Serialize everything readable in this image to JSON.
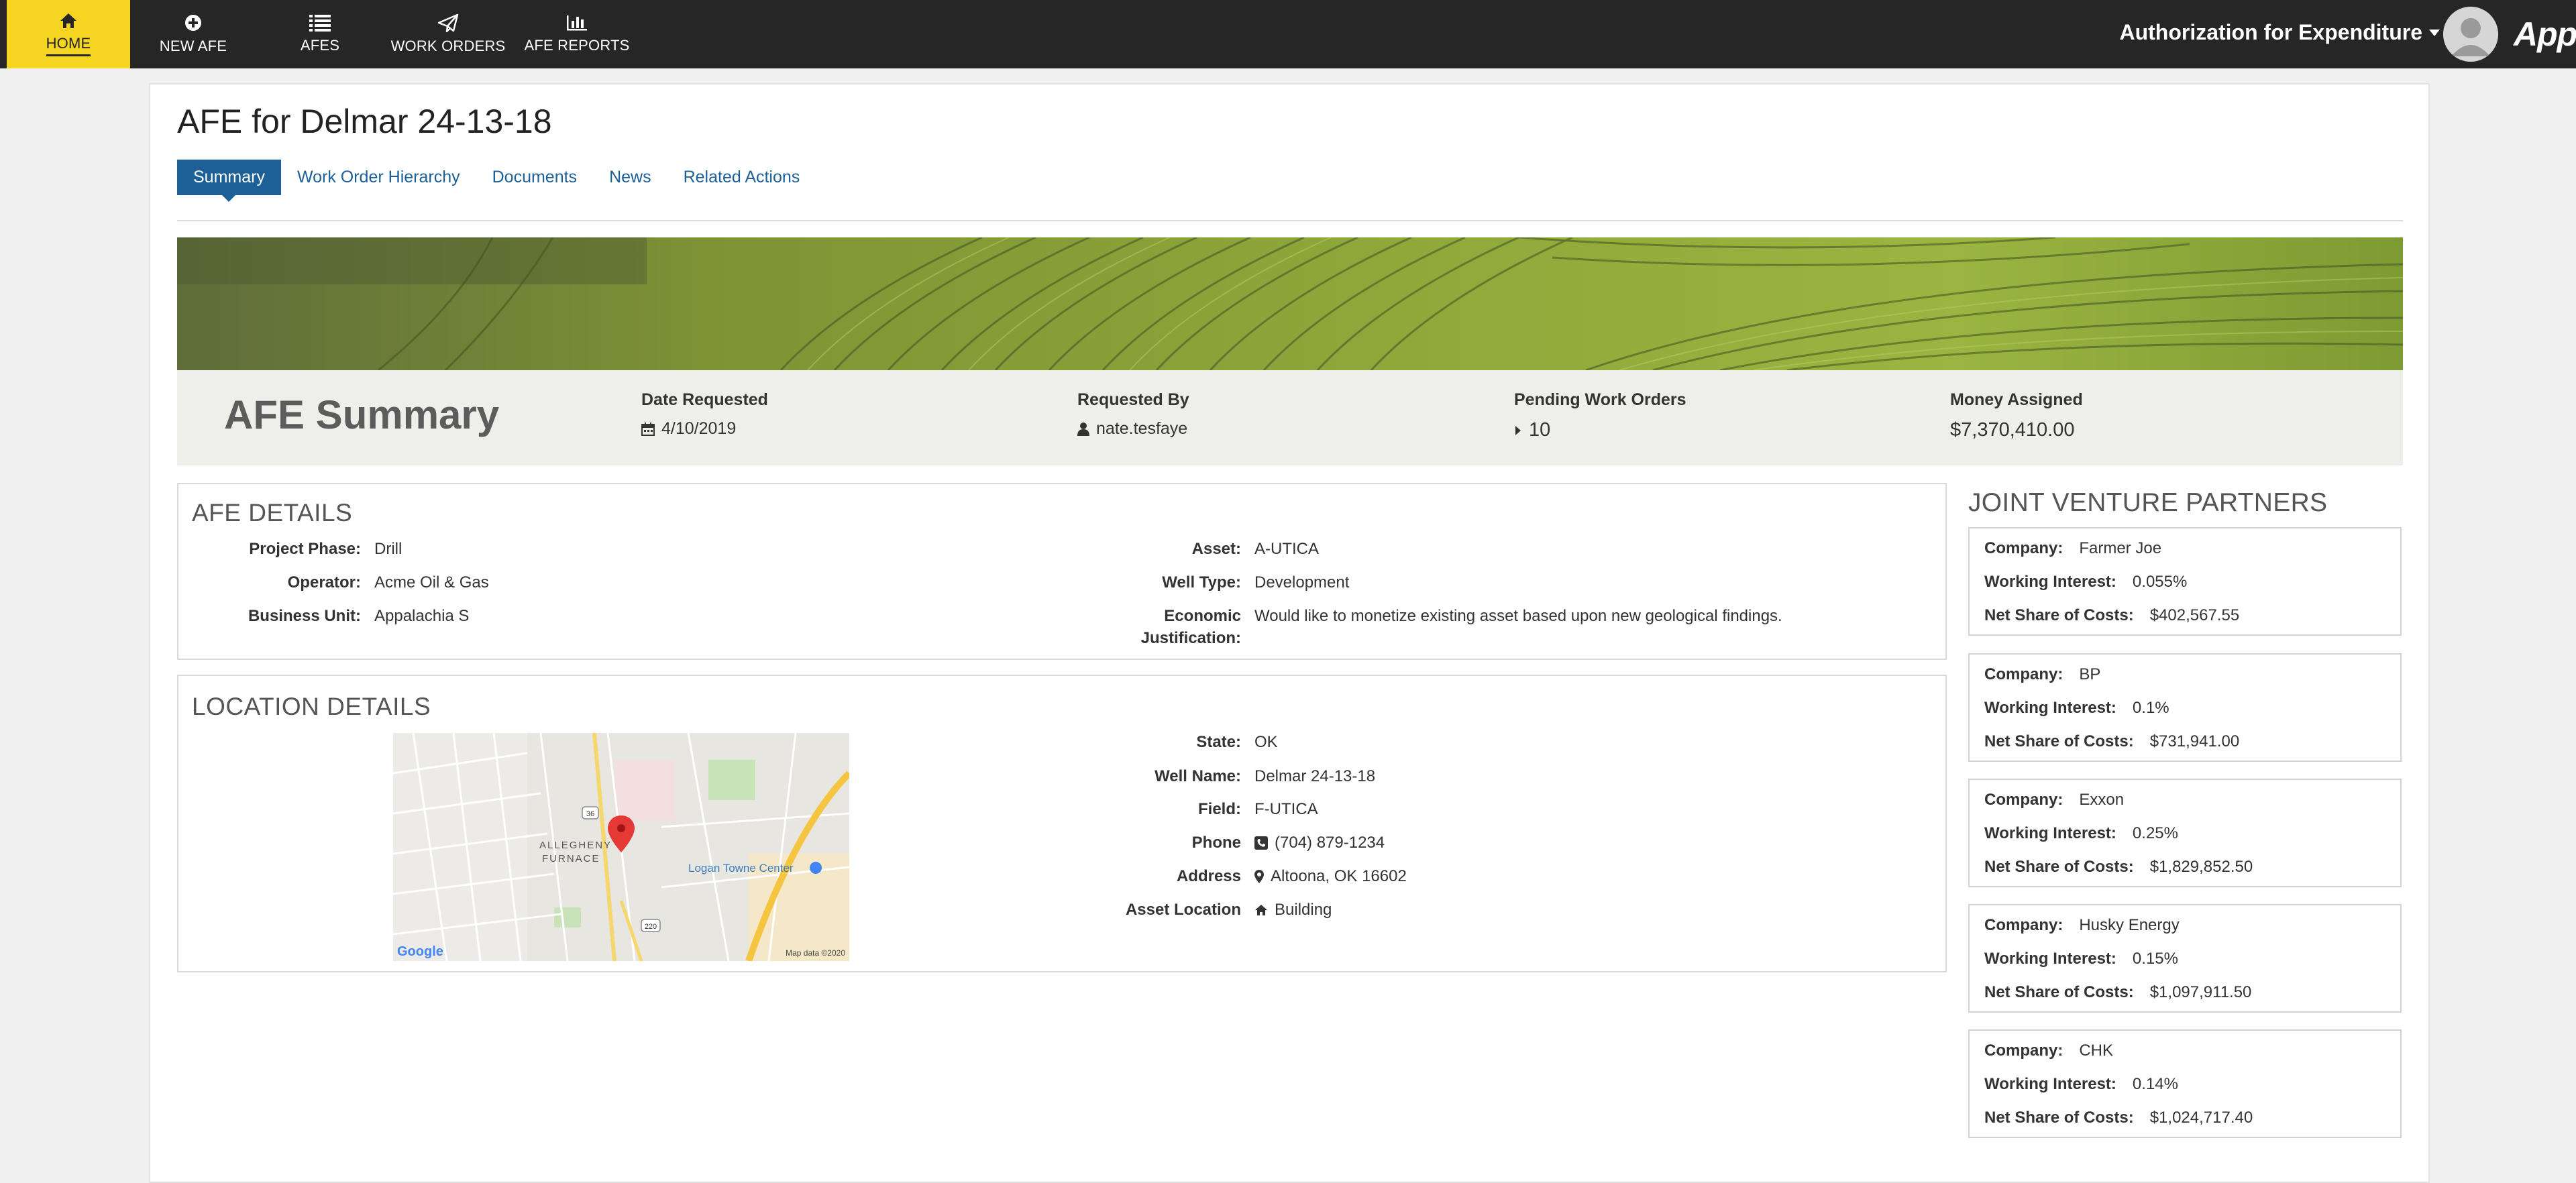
{
  "nav": {
    "items": [
      {
        "label": "HOME",
        "icon": "home-icon"
      },
      {
        "label": "NEW AFE",
        "icon": "plus-circle-icon"
      },
      {
        "label": "AFES",
        "icon": "list-icon"
      },
      {
        "label": "WORK ORDERS",
        "icon": "paper-plane-icon"
      },
      {
        "label": "AFE REPORTS",
        "icon": "bar-chart-icon"
      }
    ],
    "app_title": "Authorization for Expenditure",
    "brand": "Appian"
  },
  "page": {
    "title": "AFE for Delmar 24-13-18",
    "tabs": [
      "Summary",
      "Work Order Hierarchy",
      "Documents",
      "News",
      "Related Actions"
    ],
    "active_tab": "Summary"
  },
  "summary": {
    "heading": "AFE Summary",
    "date_requested": {
      "label": "Date Requested",
      "value": "4/10/2019"
    },
    "requested_by": {
      "label": "Requested By",
      "value": "nate.tesfaye"
    },
    "pending_work_orders": {
      "label": "Pending Work Orders",
      "value": "10"
    },
    "money_assigned": {
      "label": "Money Assigned",
      "value": "$7,370,410.00"
    }
  },
  "afe_details": {
    "heading": "AFE DETAILS",
    "project_phase": {
      "label": "Project Phase:",
      "value": "Drill"
    },
    "operator": {
      "label": "Operator:",
      "value": "Acme Oil & Gas"
    },
    "business_unit": {
      "label": "Business Unit:",
      "value": "Appalachia S"
    },
    "asset": {
      "label": "Asset:",
      "value": "A-UTICA"
    },
    "well_type": {
      "label": "Well Type:",
      "value": "Development"
    },
    "economic_justification": {
      "label_line1": "Economic",
      "label_line2": "Justification:",
      "value": "Would like to monetize existing asset based upon new geological findings."
    }
  },
  "location_details": {
    "heading": "LOCATION DETAILS",
    "state": {
      "label": "State:",
      "value": "OK"
    },
    "well_name": {
      "label": "Well Name:",
      "value": "Delmar 24-13-18"
    },
    "field": {
      "label": "Field:",
      "value": "F-UTICA"
    },
    "phone": {
      "label": "Phone",
      "value": "(704) 879-1234"
    },
    "address": {
      "label": "Address",
      "value": "Altoona, OK 16602"
    },
    "asset_location": {
      "label": "Asset Location",
      "value": "Building"
    },
    "map": {
      "area_label_1": "ALLEGHENY",
      "area_label_2": "FURNACE",
      "poi": "Logan Towne Center",
      "road_1": "36",
      "road_2": "220",
      "provider": "Google",
      "attribution": "Map data ©2020"
    }
  },
  "jv": {
    "heading": "JOINT VENTURE PARTNERS",
    "labels": {
      "company": "Company:",
      "working_interest": "Working Interest:",
      "net_share": "Net Share of Costs:"
    },
    "partners": [
      {
        "company": "Farmer Joe",
        "working_interest": "0.055%",
        "net_share": "$402,567.55"
      },
      {
        "company": "BP",
        "working_interest": "0.1%",
        "net_share": "$731,941.00"
      },
      {
        "company": "Exxon",
        "working_interest": "0.25%",
        "net_share": "$1,829,852.50"
      },
      {
        "company": "Husky Energy",
        "working_interest": "0.15%",
        "net_share": "$1,097,911.50"
      },
      {
        "company": "CHK",
        "working_interest": "0.14%",
        "net_share": "$1,024,717.40"
      }
    ]
  },
  "colors": {
    "nav_bg": "#262626",
    "nav_active": "#f5d422",
    "tab_active": "#1d5f97",
    "link": "#1d5f97",
    "map_pin": "#e53935"
  }
}
